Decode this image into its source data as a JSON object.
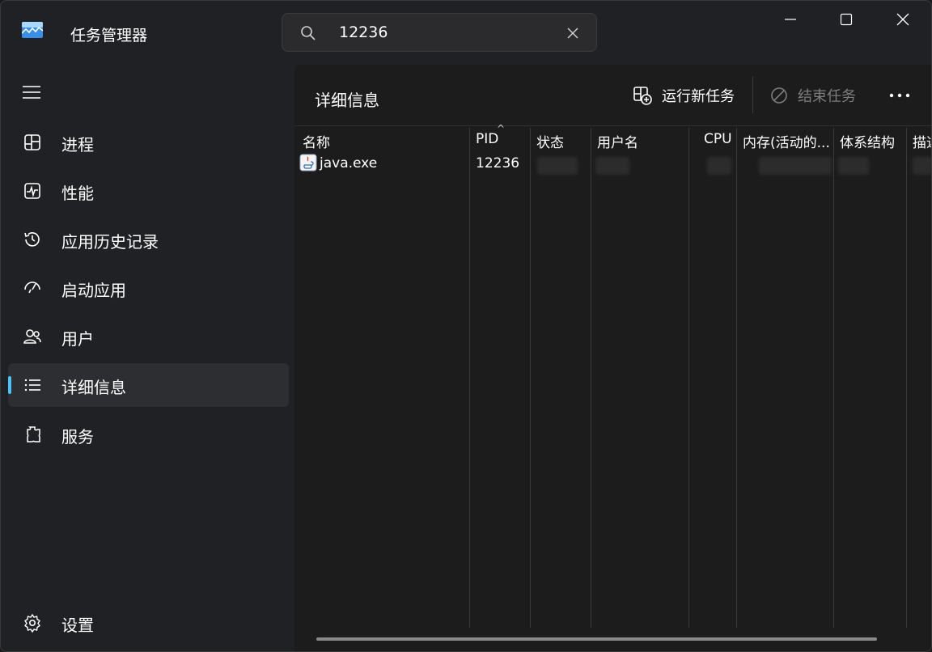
{
  "app": {
    "title": "任务管理器",
    "logo_icon": "task-manager-logo-icon"
  },
  "search": {
    "value": "12236",
    "icon": "search-icon",
    "clear_icon": "close-icon"
  },
  "window_controls": [
    "minimize-icon",
    "maximize-icon",
    "close-icon"
  ],
  "sidebar": {
    "menu_icon": "hamburger-menu-icon",
    "items": [
      {
        "label": "进程",
        "icon": "processes-icon"
      },
      {
        "label": "性能",
        "icon": "performance-icon"
      },
      {
        "label": "应用历史记录",
        "icon": "history-icon"
      },
      {
        "label": "启动应用",
        "icon": "startup-icon"
      },
      {
        "label": "用户",
        "icon": "users-icon"
      },
      {
        "label": "详细信息",
        "icon": "details-icon",
        "active": true
      },
      {
        "label": "服务",
        "icon": "services-icon"
      }
    ],
    "settings": {
      "label": "设置",
      "icon": "gear-icon"
    }
  },
  "main": {
    "title": "详细信息",
    "toolbar": {
      "run_task_label": "运行新任务",
      "end_task_label": "结束任务",
      "more_icon": "more-icon"
    },
    "table": {
      "columns": [
        "名称",
        "PID",
        "状态",
        "用户名",
        "CPU",
        "内存(活动的...",
        "体系结构",
        "描述"
      ],
      "sorted_column": "PID",
      "rows": [
        {
          "name": "java.exe",
          "pid": "12236",
          "icon": "java-icon"
        }
      ]
    }
  },
  "colors": {
    "accent": "#4cc2ff",
    "background": "#202125",
    "panel": "#1c1c1c"
  }
}
